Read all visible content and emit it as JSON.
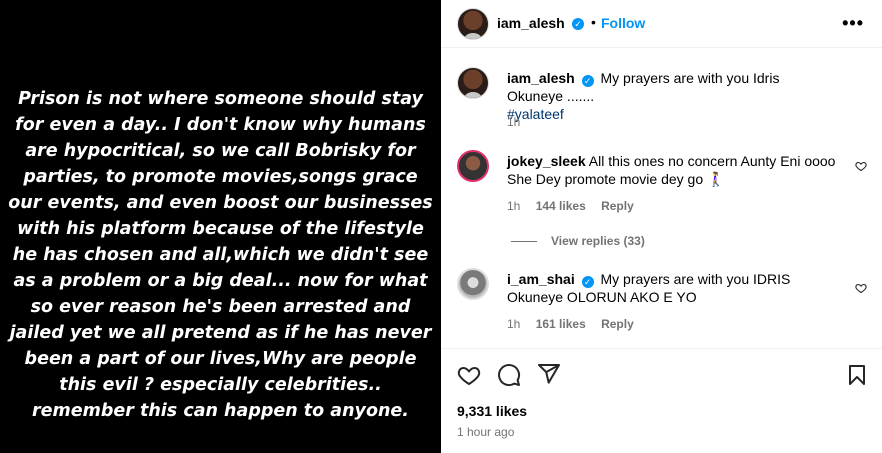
{
  "story": {
    "text": "Prison is not where someone should stay for even a day.. I don't know why humans are hypocritical, so we call Bobrisky for parties, to promote movies,songs grace our events, and even boost our businesses with his platform because of the lifestyle he has chosen and all,which we didn't see as a problem or a big deal... now for what so ever reason he's been arrested and jailed yet we all pretend as if he has never been a part of our lives,Why are people this evil ? especially celebrities.. remember this can happen to anyone."
  },
  "header": {
    "username": "iam_alesh",
    "separator": "•",
    "follow_label": "Follow",
    "more_label": "•••"
  },
  "caption": {
    "username": "iam_alesh",
    "text": "My prayers are with you Idris Okuneye .......",
    "hashtag": "#yalateef",
    "time": "1h"
  },
  "comments": [
    {
      "username": "jokey_sleek",
      "text": "All this ones no concern Aunty Eni oooo She Dey promote movie dey go 🚶‍♀️",
      "time": "1h",
      "likes": "144 likes",
      "reply": "Reply",
      "view_replies": "View replies (33)"
    },
    {
      "username": "i_am_shai",
      "text": "My prayers are with you IDRIS Okuneye OLORUN AKO E YO",
      "time": "1h",
      "likes": "161 likes",
      "reply": "Reply"
    }
  ],
  "footer": {
    "likes": "9,331 likes",
    "time": "1 hour ago"
  },
  "colors": {
    "accent": "#0095f6",
    "muted": "#737373",
    "hashtag": "#00376b"
  }
}
